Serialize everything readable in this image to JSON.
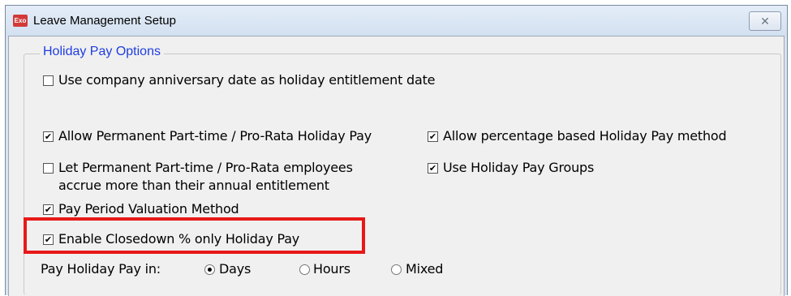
{
  "window": {
    "title": "Leave Management Setup",
    "app_icon_text": "Exo",
    "close_glyph": "✕"
  },
  "group": {
    "title": "Holiday Pay Options"
  },
  "options": {
    "anniversary": {
      "label": "Use company anniversary date as holiday entitlement date",
      "checked": false
    },
    "allow_prorata": {
      "label": "Allow Permanent Part-time / Pro-Rata Holiday Pay",
      "checked": true
    },
    "allow_percentage": {
      "label": "Allow percentage based Holiday Pay method",
      "checked": true
    },
    "let_accrue": {
      "label_line1": "Let Permanent Part-time / Pro-Rata employees",
      "label_line2": "accrue more than their annual entitlement",
      "checked": false
    },
    "use_groups": {
      "label": "Use Holiday Pay Groups",
      "checked": true
    },
    "pay_period_valuation": {
      "label": "Pay Period Valuation Method",
      "checked": true
    },
    "closedown": {
      "label": "Enable Closedown % only Holiday Pay",
      "checked": true
    }
  },
  "pay_in": {
    "label": "Pay Holiday Pay in:",
    "choices": [
      "Days",
      "Hours",
      "Mixed"
    ],
    "selected": "Days"
  },
  "highlight_color": "#e81818",
  "check_glyph": "✔"
}
